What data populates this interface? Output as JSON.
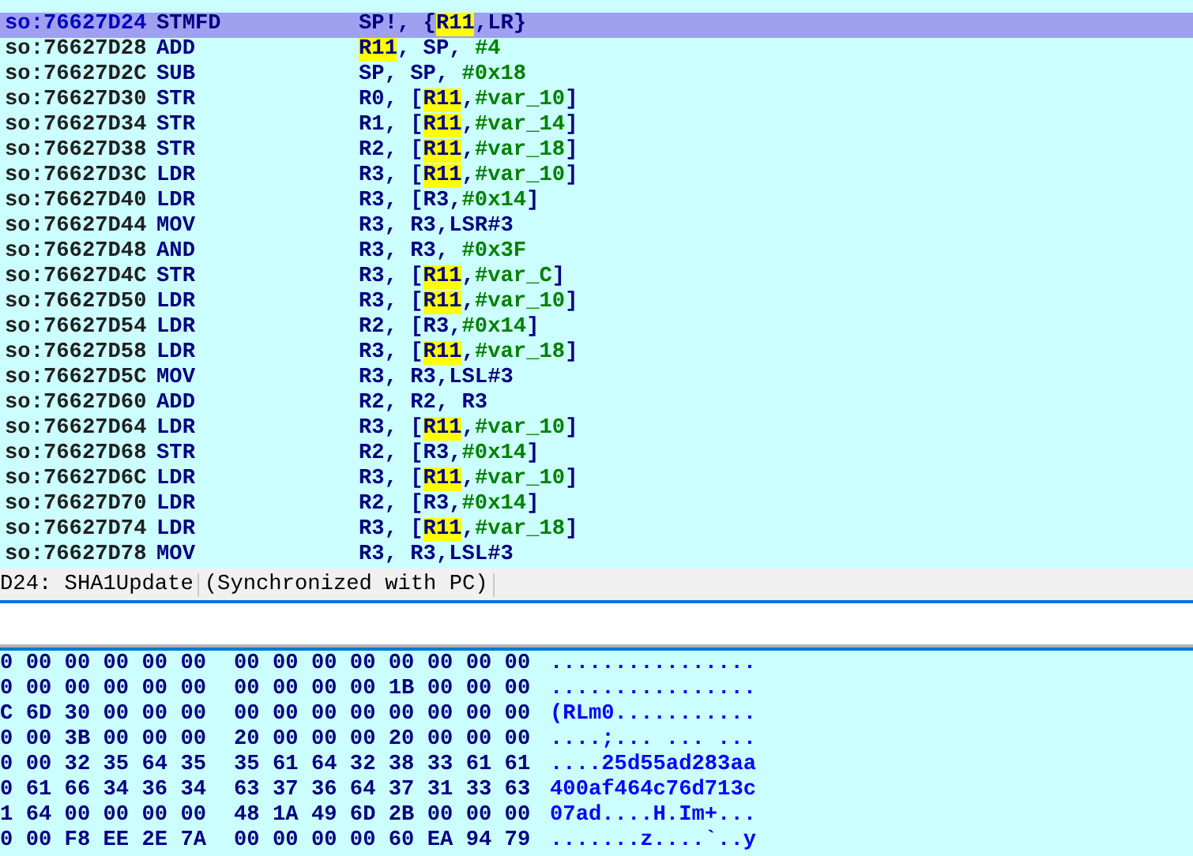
{
  "disassembly": {
    "rows": [
      {
        "address": "so:76627D24",
        "mnemonic": "STMFD",
        "selected": true,
        "operands": [
          {
            "kind": "text",
            "text": "SP!, {"
          },
          {
            "kind": "highlight",
            "text": "R11"
          },
          {
            "kind": "text",
            "text": ",LR}"
          }
        ]
      },
      {
        "address": "so:76627D28",
        "mnemonic": "ADD",
        "selected": false,
        "operands": [
          {
            "kind": "highlight",
            "text": "R11"
          },
          {
            "kind": "text",
            "text": ", SP, "
          },
          {
            "kind": "immediate",
            "text": "#4"
          }
        ]
      },
      {
        "address": "so:76627D2C",
        "mnemonic": "SUB",
        "selected": false,
        "operands": [
          {
            "kind": "text",
            "text": "SP, SP, "
          },
          {
            "kind": "immediate",
            "text": "#0x18"
          }
        ]
      },
      {
        "address": "so:76627D30",
        "mnemonic": "STR",
        "selected": false,
        "operands": [
          {
            "kind": "text",
            "text": "R0, ["
          },
          {
            "kind": "highlight",
            "text": "R11"
          },
          {
            "kind": "text",
            "text": ","
          },
          {
            "kind": "immediate",
            "text": "#var_10"
          },
          {
            "kind": "text",
            "text": "]"
          }
        ]
      },
      {
        "address": "so:76627D34",
        "mnemonic": "STR",
        "selected": false,
        "operands": [
          {
            "kind": "text",
            "text": "R1, ["
          },
          {
            "kind": "highlight",
            "text": "R11"
          },
          {
            "kind": "text",
            "text": ","
          },
          {
            "kind": "immediate",
            "text": "#var_14"
          },
          {
            "kind": "text",
            "text": "]"
          }
        ]
      },
      {
        "address": "so:76627D38",
        "mnemonic": "STR",
        "selected": false,
        "operands": [
          {
            "kind": "text",
            "text": "R2, ["
          },
          {
            "kind": "highlight",
            "text": "R11"
          },
          {
            "kind": "text",
            "text": ","
          },
          {
            "kind": "immediate",
            "text": "#var_18"
          },
          {
            "kind": "text",
            "text": "]"
          }
        ]
      },
      {
        "address": "so:76627D3C",
        "mnemonic": "LDR",
        "selected": false,
        "operands": [
          {
            "kind": "text",
            "text": "R3, ["
          },
          {
            "kind": "highlight",
            "text": "R11"
          },
          {
            "kind": "text",
            "text": ","
          },
          {
            "kind": "immediate",
            "text": "#var_10"
          },
          {
            "kind": "text",
            "text": "]"
          }
        ]
      },
      {
        "address": "so:76627D40",
        "mnemonic": "LDR",
        "selected": false,
        "operands": [
          {
            "kind": "text",
            "text": "R3, [R3,"
          },
          {
            "kind": "immediate",
            "text": "#0x14"
          },
          {
            "kind": "text",
            "text": "]"
          }
        ]
      },
      {
        "address": "so:76627D44",
        "mnemonic": "MOV",
        "selected": false,
        "operands": [
          {
            "kind": "text",
            "text": "R3, R3,LSR#3"
          }
        ]
      },
      {
        "address": "so:76627D48",
        "mnemonic": "AND",
        "selected": false,
        "operands": [
          {
            "kind": "text",
            "text": "R3, R3, "
          },
          {
            "kind": "immediate",
            "text": "#0x3F"
          }
        ]
      },
      {
        "address": "so:76627D4C",
        "mnemonic": "STR",
        "selected": false,
        "operands": [
          {
            "kind": "text",
            "text": "R3, ["
          },
          {
            "kind": "highlight",
            "text": "R11"
          },
          {
            "kind": "text",
            "text": ","
          },
          {
            "kind": "immediate",
            "text": "#var_C"
          },
          {
            "kind": "text",
            "text": "]"
          }
        ]
      },
      {
        "address": "so:76627D50",
        "mnemonic": "LDR",
        "selected": false,
        "operands": [
          {
            "kind": "text",
            "text": "R3, ["
          },
          {
            "kind": "highlight",
            "text": "R11"
          },
          {
            "kind": "text",
            "text": ","
          },
          {
            "kind": "immediate",
            "text": "#var_10"
          },
          {
            "kind": "text",
            "text": "]"
          }
        ]
      },
      {
        "address": "so:76627D54",
        "mnemonic": "LDR",
        "selected": false,
        "operands": [
          {
            "kind": "text",
            "text": "R2, [R3,"
          },
          {
            "kind": "immediate",
            "text": "#0x14"
          },
          {
            "kind": "text",
            "text": "]"
          }
        ]
      },
      {
        "address": "so:76627D58",
        "mnemonic": "LDR",
        "selected": false,
        "operands": [
          {
            "kind": "text",
            "text": "R3, ["
          },
          {
            "kind": "highlight",
            "text": "R11"
          },
          {
            "kind": "text",
            "text": ","
          },
          {
            "kind": "immediate",
            "text": "#var_18"
          },
          {
            "kind": "text",
            "text": "]"
          }
        ]
      },
      {
        "address": "so:76627D5C",
        "mnemonic": "MOV",
        "selected": false,
        "operands": [
          {
            "kind": "text",
            "text": "R3, R3,LSL#3"
          }
        ]
      },
      {
        "address": "so:76627D60",
        "mnemonic": "ADD",
        "selected": false,
        "operands": [
          {
            "kind": "text",
            "text": "R2, R2, R3"
          }
        ]
      },
      {
        "address": "so:76627D64",
        "mnemonic": "LDR",
        "selected": false,
        "operands": [
          {
            "kind": "text",
            "text": "R3, ["
          },
          {
            "kind": "highlight",
            "text": "R11"
          },
          {
            "kind": "text",
            "text": ","
          },
          {
            "kind": "immediate",
            "text": "#var_10"
          },
          {
            "kind": "text",
            "text": "]"
          }
        ]
      },
      {
        "address": "so:76627D68",
        "mnemonic": "STR",
        "selected": false,
        "operands": [
          {
            "kind": "text",
            "text": "R2, [R3,"
          },
          {
            "kind": "immediate",
            "text": "#0x14"
          },
          {
            "kind": "text",
            "text": "]"
          }
        ]
      },
      {
        "address": "so:76627D6C",
        "mnemonic": "LDR",
        "selected": false,
        "operands": [
          {
            "kind": "text",
            "text": "R3, ["
          },
          {
            "kind": "highlight",
            "text": "R11"
          },
          {
            "kind": "text",
            "text": ","
          },
          {
            "kind": "immediate",
            "text": "#var_10"
          },
          {
            "kind": "text",
            "text": "]"
          }
        ]
      },
      {
        "address": "so:76627D70",
        "mnemonic": "LDR",
        "selected": false,
        "operands": [
          {
            "kind": "text",
            "text": "R2, [R3,"
          },
          {
            "kind": "immediate",
            "text": "#0x14"
          },
          {
            "kind": "text",
            "text": "]"
          }
        ]
      },
      {
        "address": "so:76627D74",
        "mnemonic": "LDR",
        "selected": false,
        "operands": [
          {
            "kind": "text",
            "text": "R3, ["
          },
          {
            "kind": "highlight",
            "text": "R11"
          },
          {
            "kind": "text",
            "text": ","
          },
          {
            "kind": "immediate",
            "text": "#var_18"
          },
          {
            "kind": "text",
            "text": "]"
          }
        ]
      },
      {
        "address": "so:76627D78",
        "mnemonic": "MOV",
        "selected": false,
        "operands": [
          {
            "kind": "text",
            "text": "R3, R3,LSL#3"
          }
        ]
      }
    ]
  },
  "status_bar": {
    "location": "D24: SHA1Update",
    "sync": "(Synchronized with PC)"
  },
  "hex_view": {
    "rows": [
      {
        "bytes_1": "0 00 00 00 00 00",
        "bytes_2": "00 00 00 00 00 00 00 00",
        "ascii": "................"
      },
      {
        "bytes_1": "0 00 00 00 00 00",
        "bytes_2": "00 00 00 00 1B 00 00 00",
        "ascii": "................"
      },
      {
        "bytes_1": "C 6D 30 00 00 00",
        "bytes_2": "00 00 00 00 00 00 00 00",
        "ascii": "(RLm0..........."
      },
      {
        "bytes_1": "0 00 3B 00 00 00",
        "bytes_2": "20 00 00 00 20 00 00 00",
        "ascii": "....;... ... ..."
      },
      {
        "bytes_1": "0 00 32 35 64 35",
        "bytes_2": "35 61 64 32 38 33 61 61",
        "ascii": "....25d55ad283aa"
      },
      {
        "bytes_1": "0 61 66 34 36 34",
        "bytes_2": "63 37 36 64 37 31 33 63",
        "ascii": "400af464c76d713c"
      },
      {
        "bytes_1": "1 64 00 00 00 00",
        "bytes_2": "48 1A 49 6D 2B 00 00 00",
        "ascii": "07ad....H.Im+..."
      },
      {
        "bytes_1": "0 00 F8 EE 2E 7A",
        "bytes_2": "00 00 00 00 60 EA 94 79",
        "ascii": ".......z....`..y"
      }
    ]
  }
}
